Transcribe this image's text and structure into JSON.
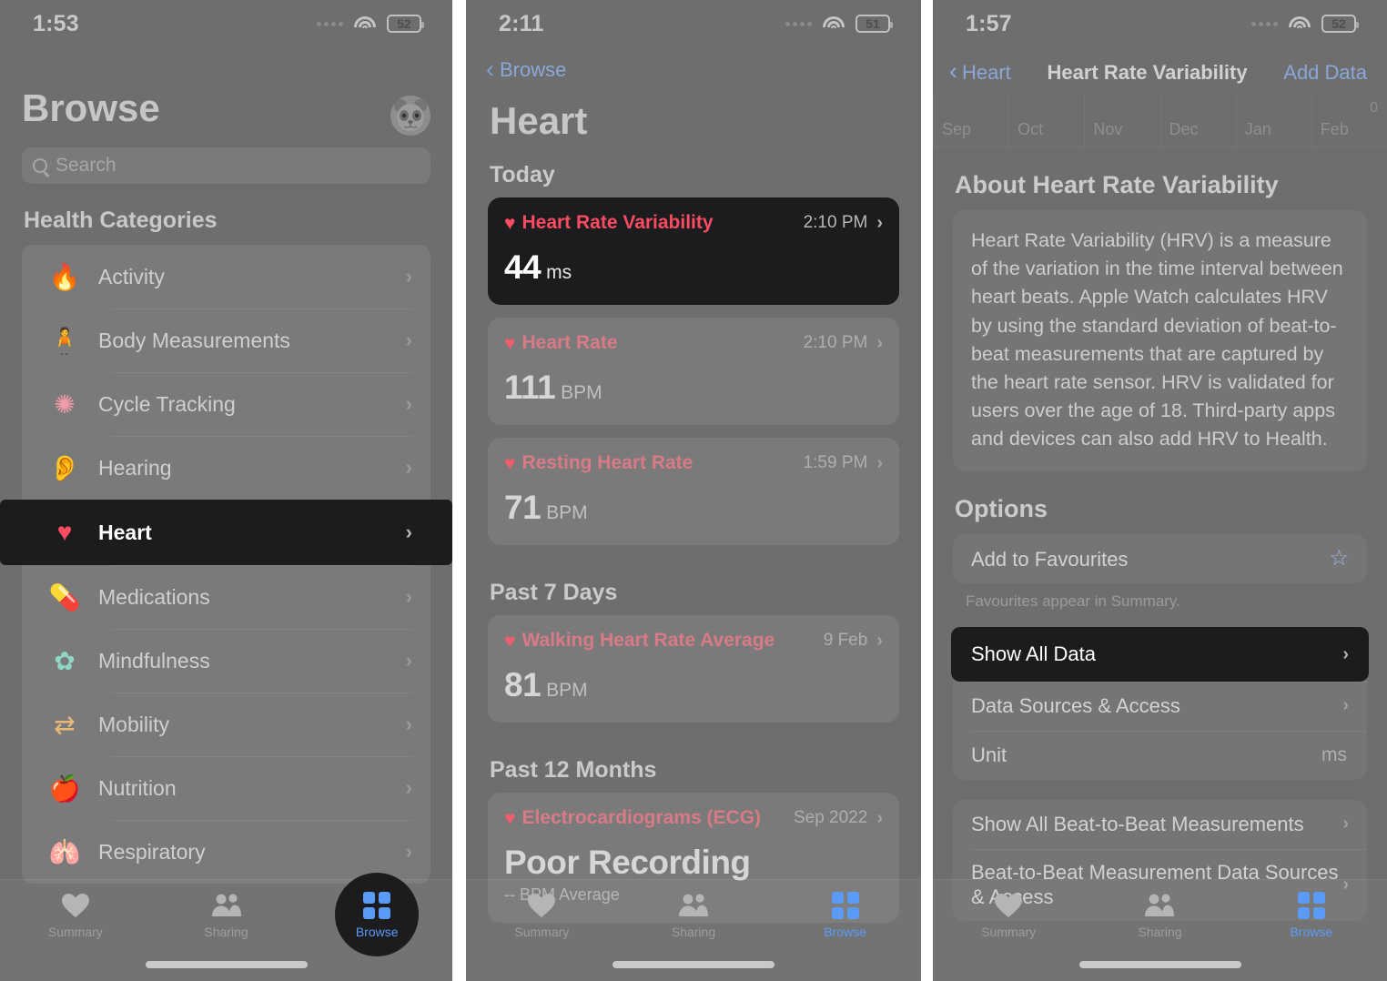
{
  "panels": {
    "browse": {
      "status": {
        "time": "1:53",
        "battery": "52",
        "wifi_icon": "wifi-icon",
        "signal_icon": "cellular-dots-icon"
      },
      "title": "Browse",
      "avatar_icon": "panda-avatar-icon",
      "search": {
        "placeholder": "Search",
        "icon": "search-icon"
      },
      "section_header": "Health Categories",
      "categories": [
        {
          "label": "Activity",
          "icon": "flame-icon",
          "glyph": "🔥",
          "color": "#e8a07a",
          "highlighted": false
        },
        {
          "label": "Body Measurements",
          "icon": "body-icon",
          "glyph": "🧍",
          "color": "#a98fe0",
          "highlighted": false
        },
        {
          "label": "Cycle Tracking",
          "icon": "cycle-icon",
          "glyph": "✺",
          "color": "#f09ba8",
          "highlighted": false
        },
        {
          "label": "Hearing",
          "icon": "ear-icon",
          "glyph": "👂",
          "color": "#7fa6e8",
          "highlighted": false
        },
        {
          "label": "Heart",
          "icon": "heart-icon",
          "glyph": "♥",
          "color": "#fc4b62",
          "highlighted": true
        },
        {
          "label": "Medications",
          "icon": "pills-icon",
          "glyph": "💊",
          "color": "#a8cbe8",
          "highlighted": false
        },
        {
          "label": "Mindfulness",
          "icon": "brain-icon",
          "glyph": "✿",
          "color": "#8fd6c4",
          "highlighted": false
        },
        {
          "label": "Mobility",
          "icon": "arrows-icon",
          "glyph": "⇄",
          "color": "#e8b878",
          "highlighted": false
        },
        {
          "label": "Nutrition",
          "icon": "apple-icon",
          "glyph": "🍎",
          "color": "#8fd67a",
          "highlighted": false
        },
        {
          "label": "Respiratory",
          "icon": "lungs-icon",
          "glyph": "🫁",
          "color": "#a8cbe8",
          "highlighted": false
        }
      ],
      "chevron": "›"
    },
    "heart": {
      "status": {
        "time": "2:11",
        "battery": "51"
      },
      "back_label": "Browse",
      "back_icon": "chevron-left-icon",
      "title": "Heart",
      "groups": [
        {
          "header": "Today",
          "items": [
            {
              "name": "Heart Rate Variability",
              "time": "2:10 PM",
              "value": "44",
              "unit": "ms",
              "sub": "",
              "highlighted": true,
              "icon": "heart-icon"
            },
            {
              "name": "Heart Rate",
              "time": "2:10 PM",
              "value": "111",
              "unit": "BPM",
              "sub": "",
              "highlighted": false,
              "icon": "heart-icon"
            },
            {
              "name": "Resting Heart Rate",
              "time": "1:59 PM",
              "value": "71",
              "unit": "BPM",
              "sub": "",
              "highlighted": false,
              "icon": "heart-icon"
            }
          ]
        },
        {
          "header": "Past 7 Days",
          "items": [
            {
              "name": "Walking Heart Rate Average",
              "time": "9 Feb",
              "value": "81",
              "unit": "BPM",
              "sub": "",
              "highlighted": false,
              "icon": "heart-icon"
            }
          ]
        },
        {
          "header": "Past 12 Months",
          "items": [
            {
              "name": "Electrocardiograms (ECG)",
              "time": "Sep 2022",
              "value": "Poor Recording",
              "unit": "",
              "sub": "-- BPM Average",
              "highlighted": false,
              "icon": "heart-icon"
            }
          ]
        }
      ]
    },
    "hrv": {
      "status": {
        "time": "1:57",
        "battery": "52"
      },
      "back_label": "Heart",
      "back_icon": "chevron-left-icon",
      "nav_title": "Heart Rate Variability",
      "action_label": "Add Data",
      "chart_axis_months": [
        "Sep",
        "Oct",
        "Nov",
        "Dec",
        "Jan",
        "Feb"
      ],
      "chart_zero_label": "0",
      "about_header": "About Heart Rate Variability",
      "about_body": "Heart Rate Variability (HRV) is a measure of the variation in the time interval between heart beats. Apple Watch calculates HRV by using the standard deviation of beat-to-beat measurements that are captured by the heart rate sensor. HRV is validated for users over the age of 18. Third-party apps and devices can also add HRV to Health.",
      "options_header": "Options",
      "favourites": {
        "label": "Add to Favourites",
        "icon": "star-icon",
        "note": "Favourites appear in Summary."
      },
      "option_group_1": [
        {
          "label": "Show All Data",
          "value": "",
          "accessory": "chevron",
          "highlighted": true
        },
        {
          "label": "Data Sources & Access",
          "value": "",
          "accessory": "chevron",
          "highlighted": false
        },
        {
          "label": "Unit",
          "value": "ms",
          "accessory": "value",
          "highlighted": false
        }
      ],
      "option_group_2": [
        {
          "label": "Show All Beat-to-Beat Measurements",
          "value": "",
          "accessory": "chevron",
          "highlighted": false
        },
        {
          "label": "Beat-to-Beat Measurement Data Sources & Access",
          "value": "",
          "accessory": "chevron",
          "highlighted": false
        }
      ]
    }
  },
  "tabbar": {
    "tabs": [
      {
        "label": "Summary",
        "icon": "heart-filled-icon",
        "active": false
      },
      {
        "label": "Sharing",
        "icon": "people-icon",
        "active": false
      },
      {
        "label": "Browse",
        "icon": "grid-icon",
        "active": true
      }
    ]
  },
  "colors": {
    "accent_blue": "#5b9bf8",
    "heart_red": "#fc4b62",
    "spotlight_bg": "#1c1c1e",
    "dim_bg": "#6e6e6e"
  }
}
